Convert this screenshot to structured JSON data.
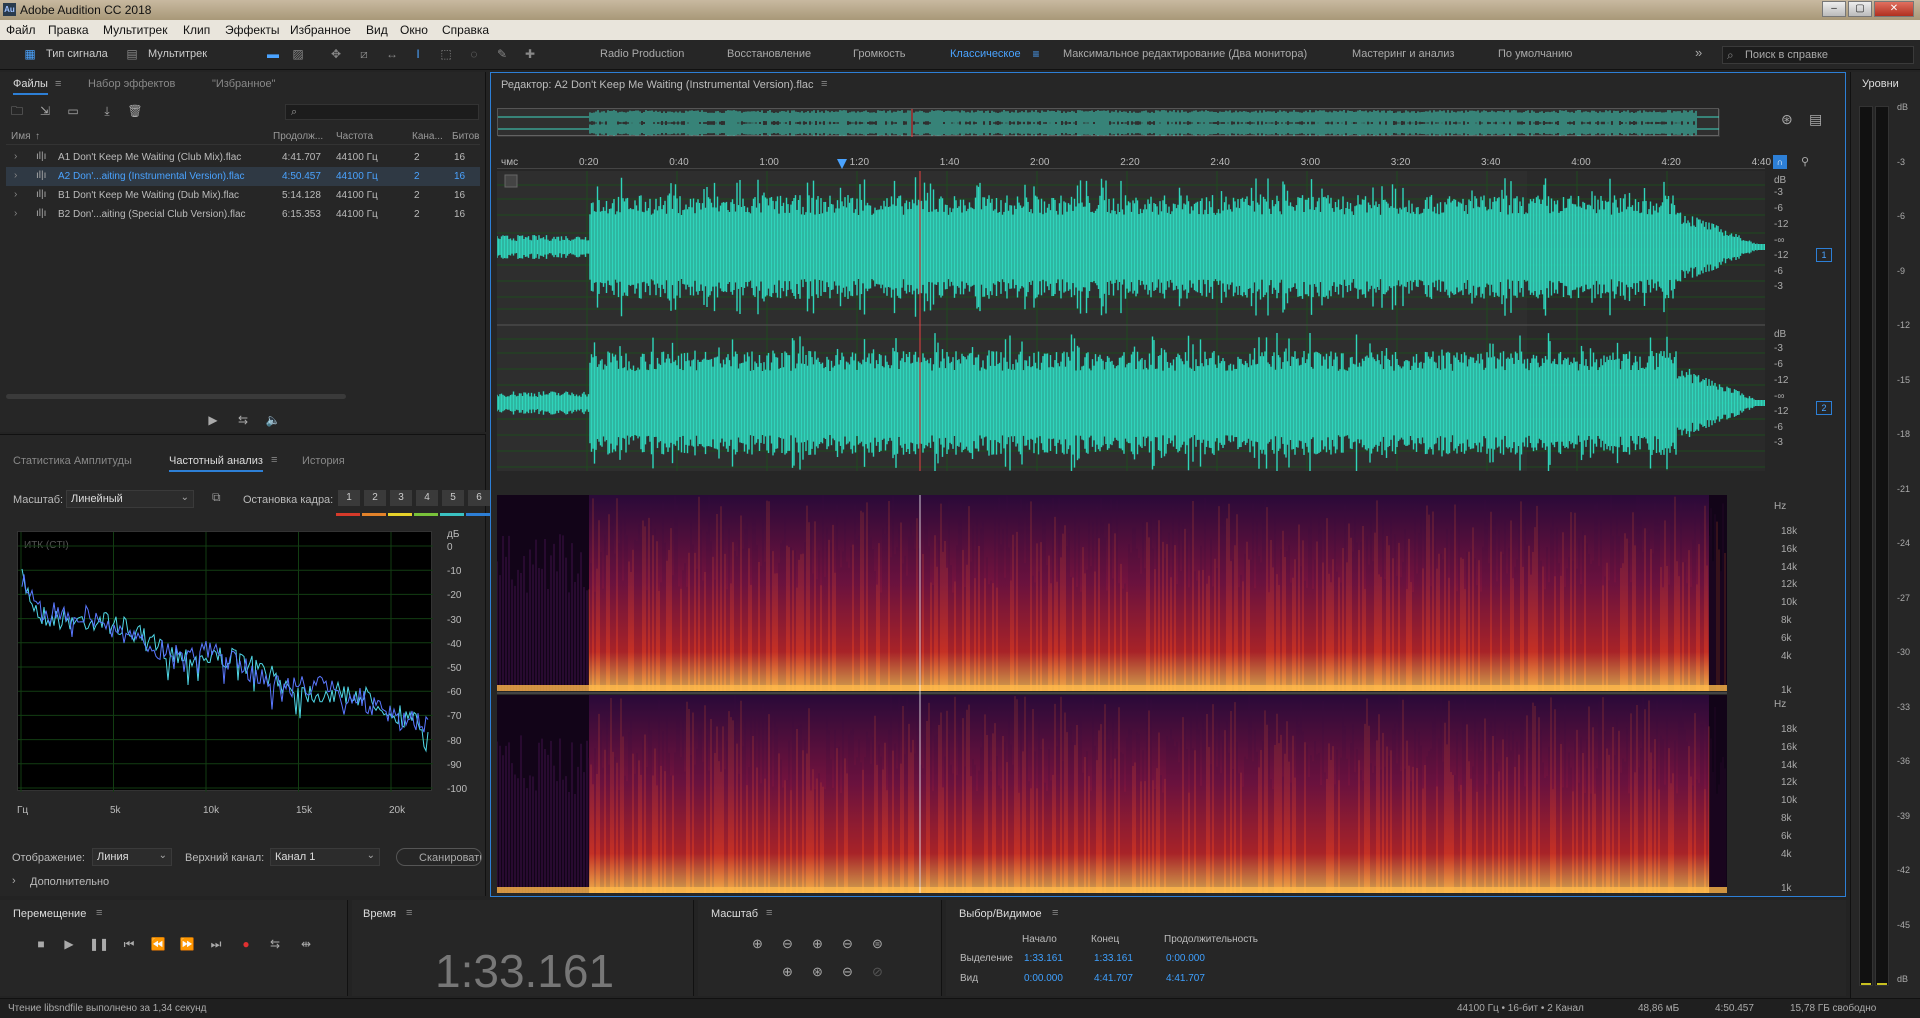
{
  "app": {
    "title": "Adobe Audition CC 2018",
    "icon": "Au"
  },
  "window_controls": [
    "–",
    "▢",
    "✕"
  ],
  "menu": [
    "Файл",
    "Правка",
    "Мультитрек",
    "Клип",
    "Эффекты",
    "Избранное",
    "Вид",
    "Окно",
    "Справка"
  ],
  "toolbar": {
    "waveform_label": "Тип сигнала",
    "multitrack_label": "Мультитрек",
    "workspaces": [
      "Radio Production",
      "Восстановление",
      "Громкость",
      "Классическое",
      "Максимальное редактирование (Два монитора)",
      "Мастеринг и анализ",
      "По умолчанию"
    ],
    "active_workspace": "Классическое",
    "more": "»",
    "search_placeholder": "Поиск в справке"
  },
  "files_panel": {
    "tabs": [
      "Файлы",
      "Набор эффектов",
      "\"Избранное\""
    ],
    "columns": [
      "Имя",
      "Продолж...",
      "Частота",
      "Кана...",
      "Битов"
    ],
    "sort_marker": "↑",
    "search_icon": "⌕",
    "rows": [
      {
        "name": "A1 Don't Keep Me Waiting (Club Mix).flac",
        "duration": "4:41.707",
        "rate": "44100 Гц",
        "ch": "2",
        "bits": "16",
        "selected": false
      },
      {
        "name": "A2 Don'...aiting (Instrumental Version).flac",
        "duration": "4:50.457",
        "rate": "44100 Гц",
        "ch": "2",
        "bits": "16",
        "selected": true
      },
      {
        "name": "B1 Don't Keep Me Waiting (Dub Mix).flac",
        "duration": "5:14.128",
        "rate": "44100 Гц",
        "ch": "2",
        "bits": "16",
        "selected": false
      },
      {
        "name": "B2 Don'...aiting (Special Club Version).flac",
        "duration": "6:15.353",
        "rate": "44100 Гц",
        "ch": "2",
        "bits": "16",
        "selected": false
      }
    ]
  },
  "freq_panel": {
    "tabs": [
      "Статистика Амплитуды",
      "Частотный анализ",
      "История"
    ],
    "scale_label": "Масштаб:",
    "scale_value": "Линейный",
    "freeze_label": "Остановка кадра:",
    "freeze_buttons": [
      "1",
      "2",
      "3",
      "4",
      "5",
      "6"
    ],
    "freeze_colors": [
      "#d63a2a",
      "#e3822a",
      "#e6d22a",
      "#79c23a",
      "#3ac2c2",
      "#2d7fd6"
    ],
    "graph_title": "ИТК (CTI)",
    "db_unit": "дБ",
    "db_ticks": [
      "0",
      "-10",
      "-20",
      "-30",
      "-40",
      "-50",
      "-60",
      "-70",
      "-80",
      "-90",
      "-100"
    ],
    "freq_ticks": [
      "Гц",
      "5k",
      "10k",
      "15k",
      "20k"
    ],
    "display_label": "Отображение:",
    "display_value": "Линия",
    "channel_label": "Верхний канал:",
    "channel_value": "Канал 1",
    "scan_button": "Сканировать",
    "advanced": "Дополнительно"
  },
  "editor": {
    "title": "Редактор: A2 Don't Keep Me Waiting (Instrumental Version).flac",
    "ruler_unit": "чмс",
    "ruler": [
      "0:20",
      "0:40",
      "1:00",
      "1:20",
      "1:40",
      "2:00",
      "2:20",
      "2:40",
      "3:00",
      "3:20",
      "3:40",
      "4:00",
      "4:20",
      "4:40"
    ],
    "db_ticks": [
      "dB",
      "-3",
      "-6",
      "-12",
      "-∞",
      "-12",
      "-6",
      "-3"
    ],
    "channels": [
      "1",
      "2"
    ],
    "hz_ticks": [
      "Hz",
      "18k",
      "16k",
      "14k",
      "12k",
      "10k",
      "8k",
      "6k",
      "4k",
      "1k"
    ],
    "colors": {
      "wave": "#2fd4bb",
      "playhead": "#e84040"
    }
  },
  "levels": {
    "title": "Уровни",
    "ticks": [
      "dB",
      "-3",
      "-6",
      "-9",
      "-12",
      "-15",
      "-18",
      "-21",
      "-24",
      "-27",
      "-30",
      "-33",
      "-36",
      "-39",
      "-42",
      "-45",
      "dB"
    ]
  },
  "transport": {
    "title": "Перемещение",
    "icons": [
      "■",
      "▶",
      "❚❚",
      "⏮",
      "⏪",
      "⏩",
      "⏭",
      "●",
      "⇆",
      "⇹"
    ]
  },
  "time": {
    "title": "Время",
    "value": "1:33.161"
  },
  "zoom": {
    "title": "Масштаб"
  },
  "selection": {
    "title": "Выбор/Видимое",
    "cols": [
      "Начало",
      "Конец",
      "Продолжительность"
    ],
    "rows": [
      {
        "label": "Выделение",
        "start": "1:33.161",
        "end": "1:33.161",
        "dur": "0:00.000"
      },
      {
        "label": "Вид",
        "start": "0:00.000",
        "end": "4:41.707",
        "dur": "4:41.707"
      }
    ]
  },
  "status": {
    "left": "Чтение libsndfile выполнено за 1,34 секунд",
    "format": "44100 Гц • 16-бит • 2 Канал",
    "size": "48,86 мБ",
    "duration": "4:50.457",
    "free": "15,78 ГБ свободно"
  }
}
